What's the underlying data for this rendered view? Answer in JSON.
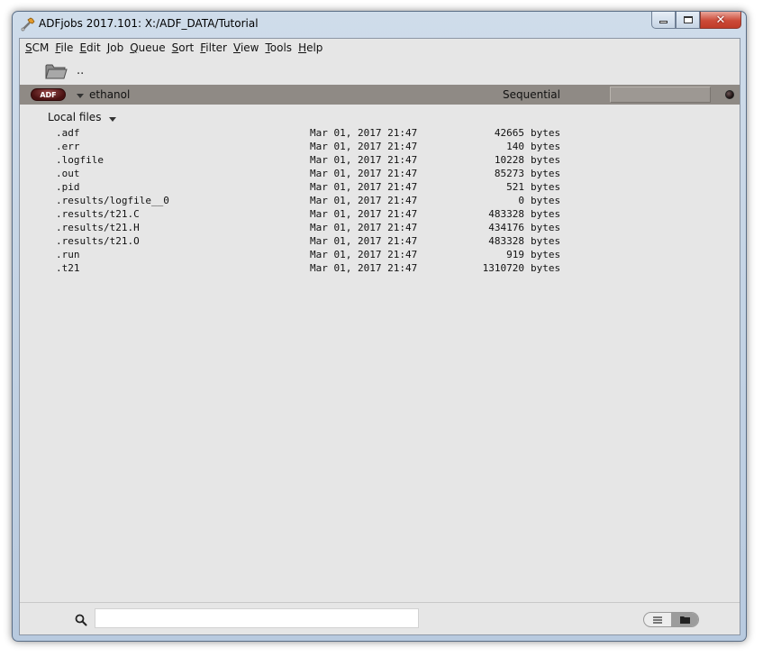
{
  "window": {
    "title": "ADFjobs 2017.101: X:/ADF_DATA/Tutorial",
    "close_glyph": "✕"
  },
  "menu": [
    "SCM",
    "File",
    "Edit",
    "Job",
    "Queue",
    "Sort",
    "Filter",
    "View",
    "Tools",
    "Help"
  ],
  "nav": {
    "up_label": ".."
  },
  "job": {
    "badge": "ADF",
    "name": "ethanol",
    "mode": "Sequential",
    "progress_value": ""
  },
  "local_files": {
    "label": "Local files",
    "files": [
      {
        "name": ".adf",
        "date": "Mar 01, 2017 21:47",
        "size": "42665",
        "unit": "bytes"
      },
      {
        "name": ".err",
        "date": "Mar 01, 2017 21:47",
        "size": "140",
        "unit": "bytes"
      },
      {
        "name": ".logfile",
        "date": "Mar 01, 2017 21:47",
        "size": "10228",
        "unit": "bytes"
      },
      {
        "name": ".out",
        "date": "Mar 01, 2017 21:47",
        "size": "85273",
        "unit": "bytes"
      },
      {
        "name": ".pid",
        "date": "Mar 01, 2017 21:47",
        "size": "521",
        "unit": "bytes"
      },
      {
        "name": ".results/logfile__0",
        "date": "Mar 01, 2017 21:47",
        "size": "0",
        "unit": "bytes"
      },
      {
        "name": ".results/t21.C",
        "date": "Mar 01, 2017 21:47",
        "size": "483328",
        "unit": "bytes"
      },
      {
        "name": ".results/t21.H",
        "date": "Mar 01, 2017 21:47",
        "size": "434176",
        "unit": "bytes"
      },
      {
        "name": ".results/t21.O",
        "date": "Mar 01, 2017 21:47",
        "size": "483328",
        "unit": "bytes"
      },
      {
        "name": ".run",
        "date": "Mar 01, 2017 21:47",
        "size": "919",
        "unit": "bytes"
      },
      {
        "name": ".t21",
        "date": "Mar 01, 2017 21:47",
        "size": "1310720",
        "unit": "bytes"
      }
    ]
  },
  "search": {
    "value": "",
    "placeholder": ""
  },
  "icons": {
    "app": "wrench-icon",
    "folder": "folder-icon",
    "search": "magnifier-icon",
    "list_view": "list-icon",
    "folder_view": "folder-icon"
  },
  "colors": {
    "job_bar": "#8f8a85",
    "badge": "#4a1212",
    "client_bg": "#e6e6e6"
  }
}
